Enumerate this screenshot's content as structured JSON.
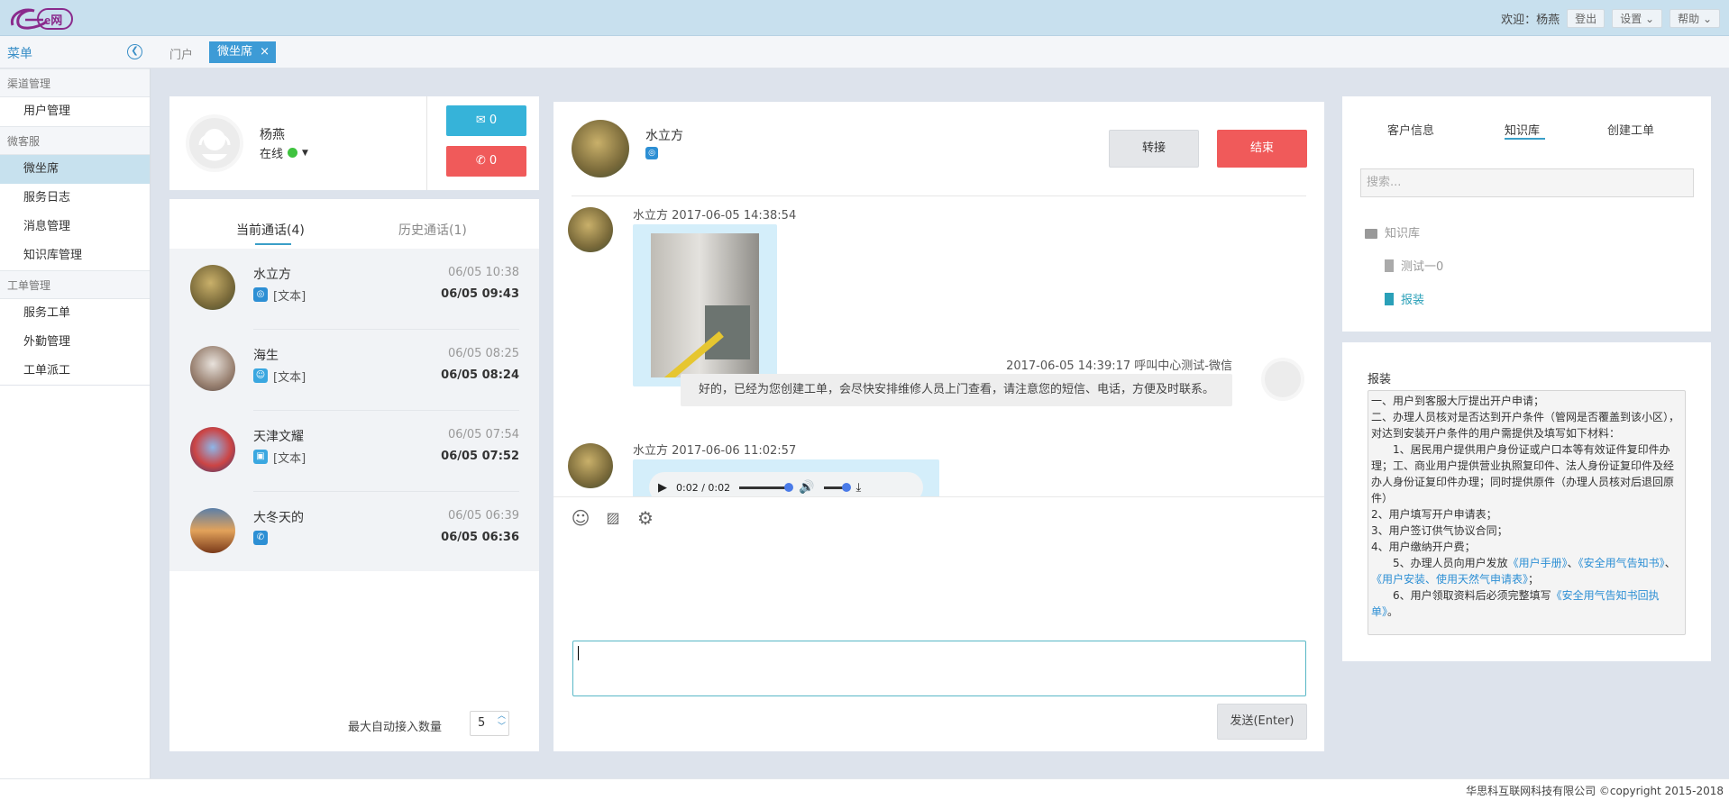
{
  "topbar": {
    "logo_text": "e网",
    "welcome": "欢迎：杨燕",
    "logout": "登出",
    "settings": "设置",
    "help": "帮助"
  },
  "tabbar": {
    "menu_title": "菜单",
    "tabs": [
      {
        "label": "门户"
      },
      {
        "label": "微坐席",
        "active": true
      }
    ],
    "close": "×"
  },
  "sidebar": {
    "groups": [
      {
        "title": "渠道管理",
        "items": [
          "用户管理"
        ]
      },
      {
        "title": "微客服",
        "items": [
          "微坐席",
          "服务日志",
          "消息管理",
          "知识库管理"
        ]
      },
      {
        "title": "工单管理",
        "items": [
          "服务工单",
          "外勤管理",
          "工单派工"
        ]
      }
    ],
    "active_item": "微坐席"
  },
  "agent": {
    "name": "杨燕",
    "status": "在线",
    "messages_count": "0",
    "calls_count": "0"
  },
  "calls": {
    "tab_current": "当前通话(4)",
    "tab_history": "历史通话(1)",
    "list": [
      {
        "name": "水立方",
        "channel": "weibo",
        "type": "[文本]",
        "time1": "06/05 10:38",
        "time2": "06/05 09:43"
      },
      {
        "name": "海生",
        "channel": "user",
        "type": "[文本]",
        "time1": "06/05 08:25",
        "time2": "06/05 08:24"
      },
      {
        "name": "天津文耀",
        "channel": "chat",
        "type": "[文本]",
        "time1": "06/05 07:54",
        "time2": "06/05 07:52"
      },
      {
        "name": "大冬天的",
        "channel": "phone",
        "type": "",
        "time1": "06/05 06:39",
        "time2": "06/05 06:36"
      }
    ],
    "max_auto_label": "最大自动接入数量",
    "max_auto_value": "5"
  },
  "chat": {
    "customer": "水立方",
    "transfer": "转接",
    "end": "结束",
    "messages": [
      {
        "sender": "水立方",
        "time": "2017-06-05 14:38:54",
        "type": "image"
      },
      {
        "sender": "呼叫中心测试-微信",
        "time": "2017-06-05 14:39:17",
        "text": "好的，已经为您创建工单，会尽快安排维修人员上门查看，请注意您的短信、电话，方便及时联系。"
      },
      {
        "sender": "水立方",
        "time": "2017-06-06 11:02:57",
        "type": "audio",
        "audio_time": "0:02 / 0:02"
      }
    ],
    "send": "发送(Enter)"
  },
  "kb": {
    "tabs": [
      "客户信息",
      "知识库",
      "创建工单"
    ],
    "active_tab": "知识库",
    "search_placeholder": "搜索...",
    "tree": {
      "root": "知识库",
      "children": [
        "测试一0",
        "报装"
      ]
    }
  },
  "kb_detail": {
    "title": "报装",
    "lines": [
      "一、用户到客服大厅提出开户申请；",
      "二、办理人员核对是否达到开户条件（管网是否覆盖到该小区），对达到安装开户条件的用户需提供及填写如下材料：",
      "　　1、居民用户提供用户身份证或户口本等有效证件复印件办理；工、商业用户提供营业执照复印件、法人身份证复印件及经办人身份证复印件办理；同时提供原件（办理人员核对后退回原件）",
      "2、用户填写开户申请表；",
      "3、用户签订供气协议合同；",
      "4、用户缴纳开户费；"
    ],
    "line5_prefix": "　　5、办理人员向用户发放",
    "line5_links": [
      "《用户手册》",
      "《安全用气告知书》",
      "《用户安装、使用天然气申请表》"
    ],
    "line5_sep": "、",
    "line5_end": "；",
    "line6_prefix": "　　6、用户领取资料后必须完整填写",
    "line6_link": "《安全用气告知书回执单》",
    "line6_end": "。"
  },
  "footer": {
    "text": "华思科互联网科技有限公司 ©copyright 2015-2018"
  },
  "colors": {
    "accent": "#3d9bd6",
    "danger": "#f05a5a",
    "info": "#36b3d9"
  }
}
